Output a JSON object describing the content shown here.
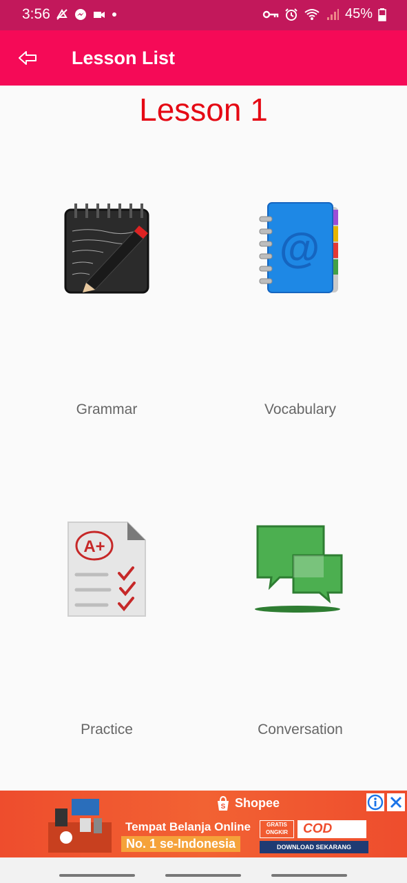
{
  "status_bar": {
    "time": "3:56",
    "battery_percent": "45%",
    "left_icons": [
      "notification-icon",
      "messenger-icon",
      "video-icon",
      "dot-icon"
    ],
    "right_icons": [
      "vpn-key-icon",
      "alarm-icon",
      "wifi-icon",
      "signal-icon",
      "battery-icon"
    ]
  },
  "app_bar": {
    "title": "Lesson List",
    "back_icon": "back-arrow-icon"
  },
  "main": {
    "heading": "Lesson 1",
    "tiles": [
      {
        "label": "Grammar",
        "icon": "notebook-pencil-icon"
      },
      {
        "label": "Vocabulary",
        "icon": "address-book-icon"
      },
      {
        "label": "Practice",
        "icon": "graded-test-icon"
      },
      {
        "label": "Conversation",
        "icon": "chat-bubbles-icon"
      }
    ]
  },
  "ad": {
    "brand": "Shopee",
    "line1": "Tempat Belanja Online",
    "line2": "No. 1 se-Indonesia",
    "free_shipping": "GRATIS ONGKIR",
    "cod": "COD",
    "download": "DOWNLOAD SEKARANG"
  },
  "colors": {
    "status_bar": "#c2185b",
    "app_bar": "#f50a57",
    "heading": "#e50914",
    "ad_orange": "#ee4d2d"
  }
}
